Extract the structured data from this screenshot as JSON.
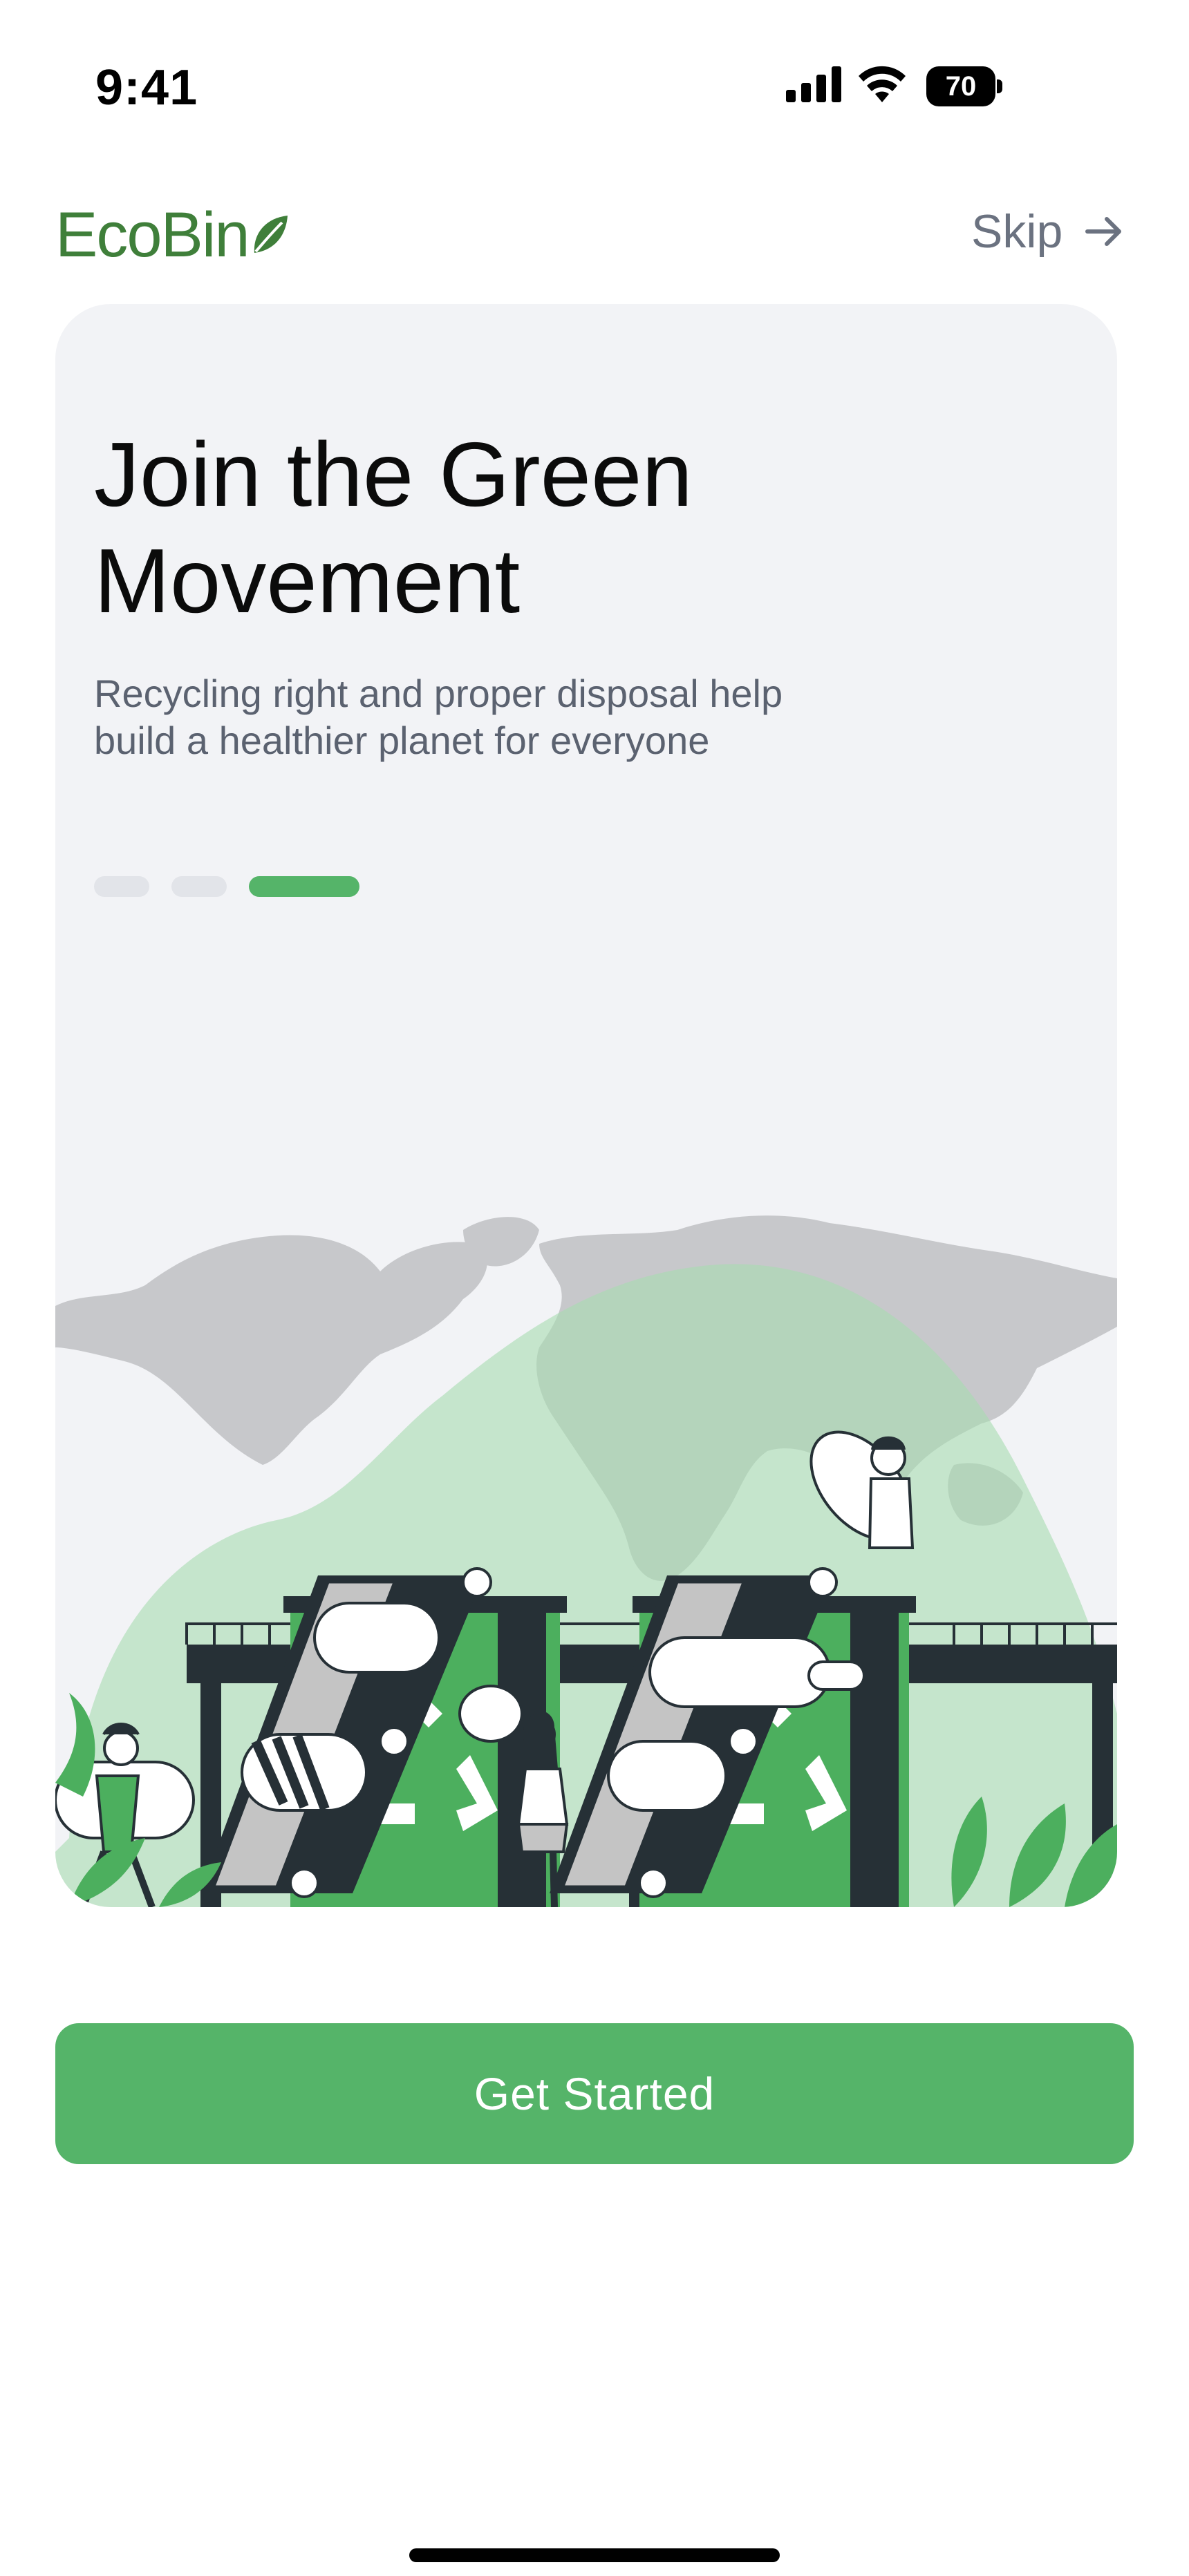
{
  "status_bar": {
    "time": "9:41",
    "battery": "70"
  },
  "header": {
    "logo": "EcoBin",
    "skip_label": "Skip"
  },
  "onboarding": {
    "title": "Join the Green Movement",
    "subtitle": "Recycling right and proper disposal help build a healthier planet for everyone",
    "pagination": {
      "total": 3,
      "current": 3
    }
  },
  "cta": {
    "label": "Get Started"
  },
  "colors": {
    "brand": "#3f7f3a",
    "accent": "#55b469",
    "card_bg": "#f2f3f6",
    "muted_text": "#5b6270"
  }
}
